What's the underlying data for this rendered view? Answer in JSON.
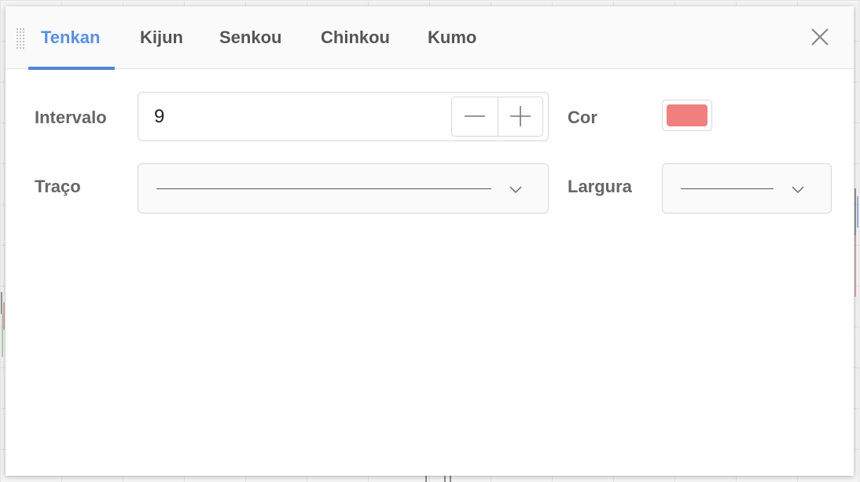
{
  "dialog": {
    "tabs": [
      {
        "label": "Tenkan",
        "active": true
      },
      {
        "label": "Kijun",
        "active": false
      },
      {
        "label": "Senkou",
        "active": false
      },
      {
        "label": "Chinkou",
        "active": false
      },
      {
        "label": "Kumo",
        "active": false
      }
    ],
    "close_icon": "close-icon",
    "drag_icon": "drag-handle-icon"
  },
  "form": {
    "interval_label": "Intervalo",
    "interval_value": "9",
    "minus_icon": "minus-icon",
    "plus_icon": "plus-icon",
    "color_label": "Cor",
    "color_value": "#f08080",
    "stroke_label": "Traço",
    "width_label": "Largura",
    "chevron_icon": "chevron-down-icon"
  },
  "colors": {
    "accent": "#4f86dc",
    "active_tab_text": "#5b8fe0"
  }
}
